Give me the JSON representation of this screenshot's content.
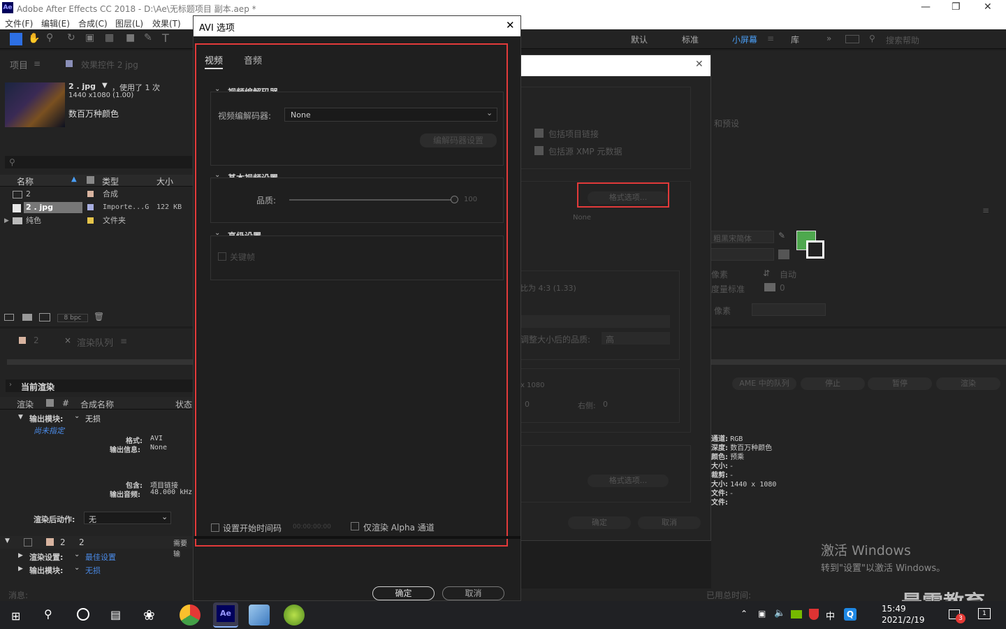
{
  "app": {
    "title": "Adobe After Effects CC 2018 - D:\\Ae\\无标题项目 副本.aep *",
    "logo": "Ae"
  },
  "menu": [
    "文件(F)",
    "编辑(E)",
    "合成(C)",
    "图层(L)",
    "效果(T)"
  ],
  "workspaces": [
    "默认",
    "标准",
    "小屏幕",
    "库"
  ],
  "search_help": "搜索帮助",
  "project": {
    "tab": "项目",
    "tab2": "效果控件 2 jpg",
    "file": "2 . jpg",
    "used": "，使用了 1 次",
    "dims": "1440 x1080 (1.00)",
    "colors": "数百万种颜色",
    "cols": [
      "名称",
      "类型",
      "大小"
    ],
    "rows": [
      {
        "name": "2",
        "type": "合成",
        "size": ""
      },
      {
        "name": "2 . jpg",
        "type": "Importe...G",
        "size": "122 KB"
      },
      {
        "name": "纯色",
        "type": "文件夹",
        "size": ""
      }
    ],
    "bpc": "8 bpc"
  },
  "render": {
    "tab1": "2",
    "tab2": "渲染队列",
    "current": "当前渲染",
    "cols": [
      "渲染",
      "#",
      "合成名称",
      "状态"
    ],
    "output_module_label": "输出模块:",
    "output_module_value": "无损",
    "not_specified": "尚未指定",
    "format_label": "格式:",
    "format_value": "AVI",
    "output_info_label": "输出信息:",
    "output_info_value": "None",
    "include_label": "包含:",
    "include_value": "项目链接",
    "audio_label": "输出音频:",
    "audio_value": "48.000 kHz",
    "post_label": "渲染后动作:",
    "post_value": "无",
    "item_num": "2",
    "item_name": "2",
    "status": "需要输",
    "render_settings_label": "渲染设置:",
    "render_settings_value": "最佳设置",
    "output_module2_label": "输出模块:",
    "output_module2_value": "无损",
    "msg": "消息:",
    "total_time": "已用总时间:"
  },
  "right": {
    "ame": "AME 中的队列",
    "stop": "停止",
    "pause": "暂停",
    "render": "渲染",
    "info": [
      {
        "k": "通道:",
        "v": "RGB"
      },
      {
        "k": "深度:",
        "v": "数百万种颜色"
      },
      {
        "k": "颜色:",
        "v": "预乘"
      },
      {
        "k": "大小:",
        "v": "-"
      },
      {
        "k": "裁剪:",
        "v": "-"
      },
      {
        "k": "大小:",
        "v": "1440 x 1080"
      },
      {
        "k": "文件:",
        "v": "-"
      },
      {
        "k": "文件:",
        "v": ""
      }
    ],
    "presets": "和预设",
    "font": "粗黑宋简体",
    "px1": "像素",
    "auto": "自动",
    "metric": "度量标准",
    "zero": "0",
    "px2": "像素"
  },
  "bgdialog": {
    "link": "包括项目链接",
    "xmp": "包括源 XMP 元数据",
    "format_opts": "格式选项...",
    "none": "None",
    "ratio": "比为 4:3 (1.33)",
    "quality_label": "调整大小后的品质:",
    "quality_value": "高",
    "size": "x 1080",
    "right": "右侧:",
    "right_val": "0",
    "left_val": "0",
    "format_opts2": "格式选项...",
    "ok": "确定",
    "cancel": "取消"
  },
  "dialog": {
    "title": "AVI 选项",
    "tabs": [
      "视频",
      "音频"
    ],
    "codec_section": "视频编解码器",
    "codec_label": "视频编解码器:",
    "codec_value": "None",
    "codec_settings": "编解码器设置",
    "basic_section": "基本视频设置",
    "quality_label": "品质:",
    "quality_value": "100",
    "adv_section": "高级设置",
    "keyframe": "关键帧",
    "start_tc": "设置开始时间码",
    "tc_value": "00:00:00:00",
    "alpha_only": "仅渲染 Alpha 通道",
    "ok": "确定",
    "cancel": "取消"
  },
  "watermark": {
    "line1": "激活 Windows",
    "line2": "转到\"设置\"以激活 Windows。",
    "brand": "最需教育"
  },
  "taskbar": {
    "time": "15:49",
    "date": "2021/2/19",
    "ime": "中",
    "badge": "3",
    "notif": "1"
  }
}
